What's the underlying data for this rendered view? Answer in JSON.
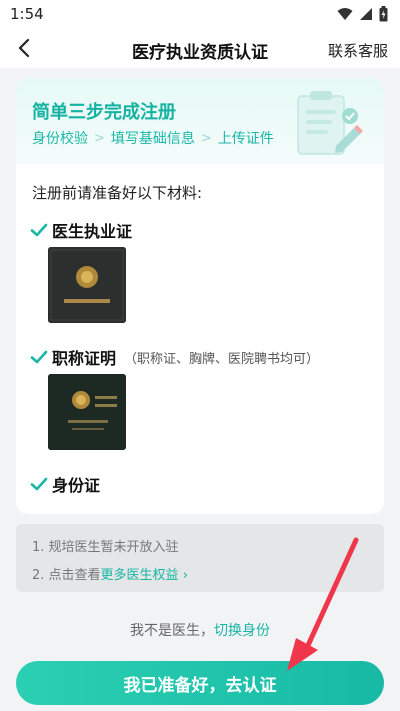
{
  "status_bar": {
    "time": "1:54"
  },
  "header": {
    "title": "医疗执业资质认证",
    "service_label": "联系客服"
  },
  "banner": {
    "title": "简单三步完成注册",
    "steps": [
      "身份校验",
      "填写基础信息",
      "上传证件"
    ],
    "separator": ">"
  },
  "materials": {
    "intro": "注册前请准备好以下材料:",
    "items": [
      {
        "label": "医生执业证",
        "note": ""
      },
      {
        "label": "职称证明",
        "note": "（职称证、胸牌、医院聘书均可）"
      },
      {
        "label": "身份证",
        "note": ""
      }
    ]
  },
  "notice": {
    "line1": "1. 规培医生暂未开放入驻",
    "line2_prefix": "2. 点击查看",
    "line2_link": "更多医生权益",
    "line2_chevron": "›"
  },
  "switch_identity": {
    "prefix": "我不是医生，",
    "link": "切换身份"
  },
  "cta": {
    "label": "我已准备好，去认证"
  },
  "colors": {
    "accent": "#17b9a5",
    "annotation_arrow": "#f0364a"
  },
  "icons": {
    "back": "chevron-left-icon",
    "check": "checkmark-icon",
    "wifi": "wifi-icon",
    "signal": "signal-icon",
    "battery": "battery-icon"
  }
}
